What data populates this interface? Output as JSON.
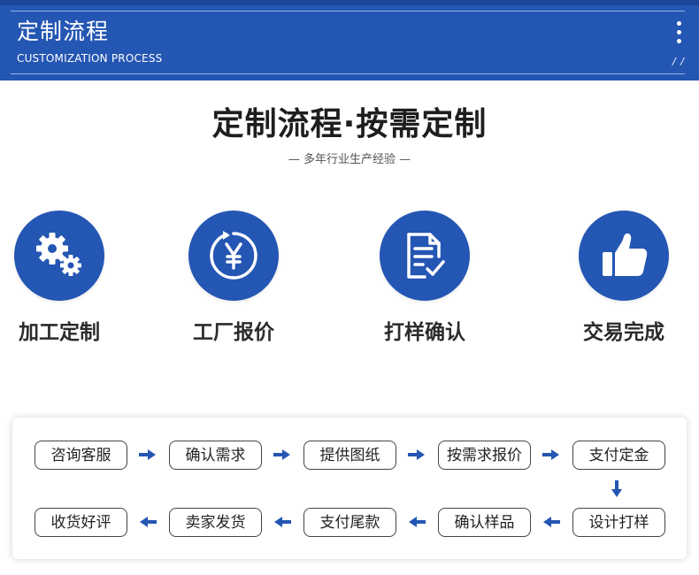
{
  "banner": {
    "title": "定制流程",
    "subtitle": "CUSTOMIZATION PROCESS",
    "slashes": "/ /",
    "bg_color": "#2456b3"
  },
  "heading": {
    "title": "定制流程·按需定制",
    "tagline": "— 多年行业生产经验 —"
  },
  "steps": [
    {
      "label": "加工定制",
      "icon": "gears-icon"
    },
    {
      "label": "工厂报价",
      "icon": "yen-cycle-icon"
    },
    {
      "label": "打样确认",
      "icon": "document-check-icon"
    },
    {
      "label": "交易完成",
      "icon": "thumbs-up-icon"
    }
  ],
  "process": {
    "row1": [
      "咨询客服",
      "确认需求",
      "提供图纸",
      "按需求报价",
      "支付定金"
    ],
    "row2": [
      "收货好评",
      "卖家发货",
      "支付尾款",
      "确认样品",
      "设计打样"
    ],
    "arrow_color": "#2456b3"
  }
}
